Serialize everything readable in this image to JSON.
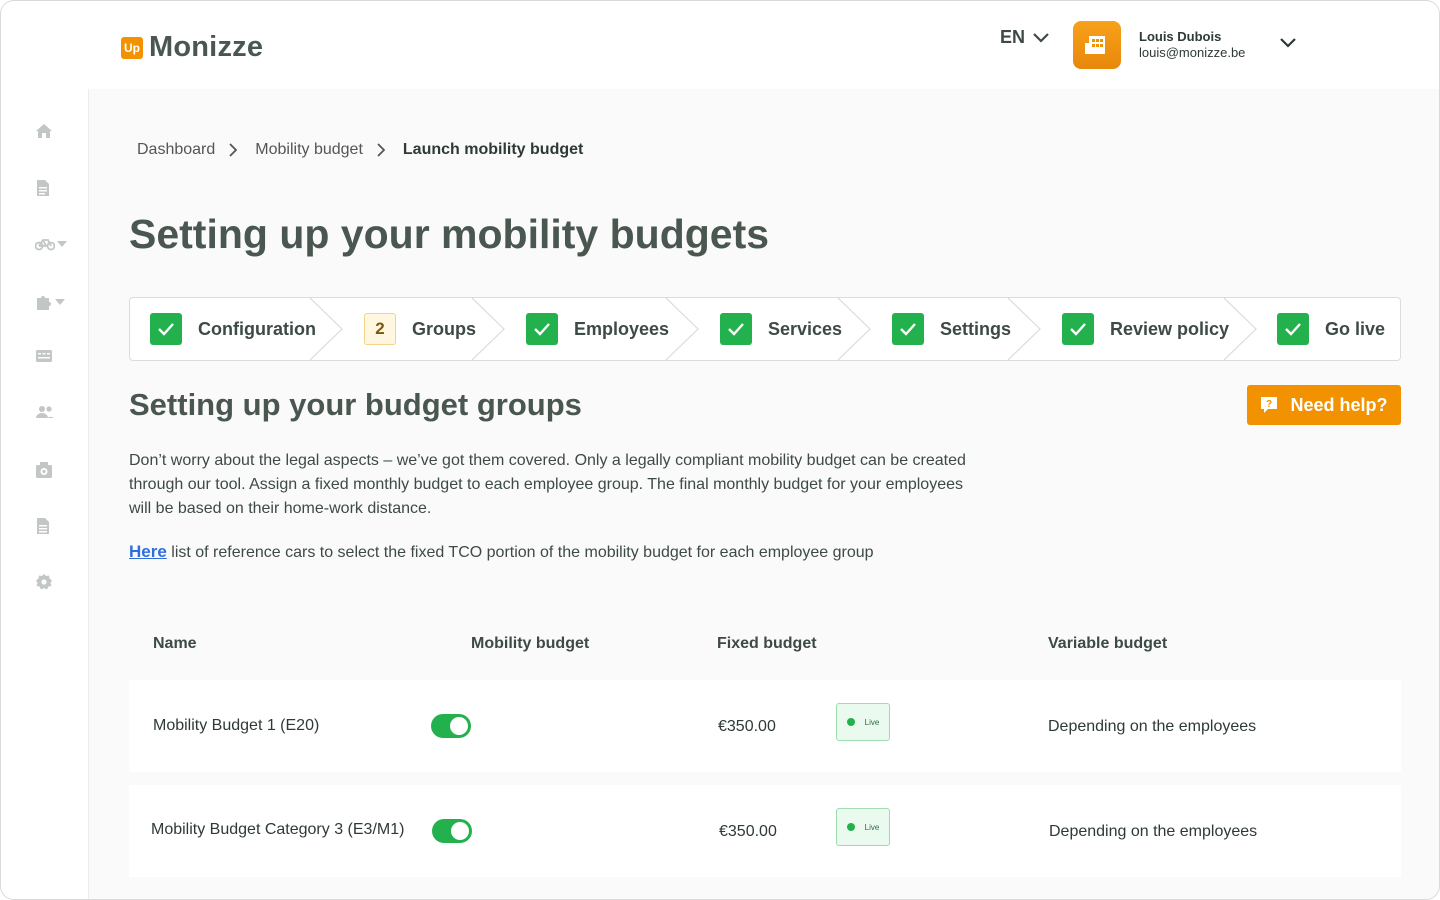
{
  "brand": {
    "badge": "Up",
    "name": "Monizze",
    "accent": "#f39200",
    "success": "#23b14d"
  },
  "header": {
    "language": "EN",
    "user": {
      "name": "Louis Dubois",
      "email": "louis@monizze.be"
    }
  },
  "sidebar": {
    "items": [
      {
        "icon": "home-icon"
      },
      {
        "icon": "document-icon"
      },
      {
        "icon": "bike-icon",
        "has_dropdown": true
      },
      {
        "icon": "puzzle-icon",
        "has_dropdown": true
      },
      {
        "icon": "card-icon"
      },
      {
        "icon": "users-icon"
      },
      {
        "icon": "money-icon"
      },
      {
        "icon": "report-icon"
      },
      {
        "icon": "gear-icon"
      }
    ]
  },
  "breadcrumb": [
    "Dashboard",
    "Mobility budget",
    "Launch mobility budget"
  ],
  "page_title": "Setting up your mobility budgets",
  "stepper": {
    "steps": [
      {
        "label": "Configuration",
        "status": "done"
      },
      {
        "label": "Groups",
        "status": "current",
        "number": "2"
      },
      {
        "label": "Employees",
        "status": "done"
      },
      {
        "label": "Services",
        "status": "done"
      },
      {
        "label": "Settings",
        "status": "done"
      },
      {
        "label": "Review policy",
        "status": "done"
      },
      {
        "label": "Go live",
        "status": "done"
      }
    ]
  },
  "section_title": "Setting up your budget groups",
  "help_button": "Need help?",
  "intro_text": "Don’t worry about the legal aspects – we’ve got them covered. Only a legally compliant mobility budget can be created through our tool. Assign a fixed monthly budget to each employee group. The final monthly budget for your employees will be based on their home-work distance.",
  "reference": {
    "link": "Here",
    "text": " list of reference cars to select the fixed TCO portion of the mobility budget for each employee group"
  },
  "table": {
    "headers": [
      "Name",
      "Mobility budget",
      "Fixed budget",
      "Variable budget"
    ],
    "rows": [
      {
        "name": "Mobility Budget 1 (E20)",
        "mobility_enabled": true,
        "fixed": "€350.00",
        "status": "Live",
        "variable": "Depending on the employees"
      },
      {
        "name": "Mobility Budget Category 3 (E3/M1)",
        "mobility_enabled": true,
        "fixed": "€350.00",
        "status": "Live",
        "variable": "Depending on the employees"
      }
    ]
  }
}
